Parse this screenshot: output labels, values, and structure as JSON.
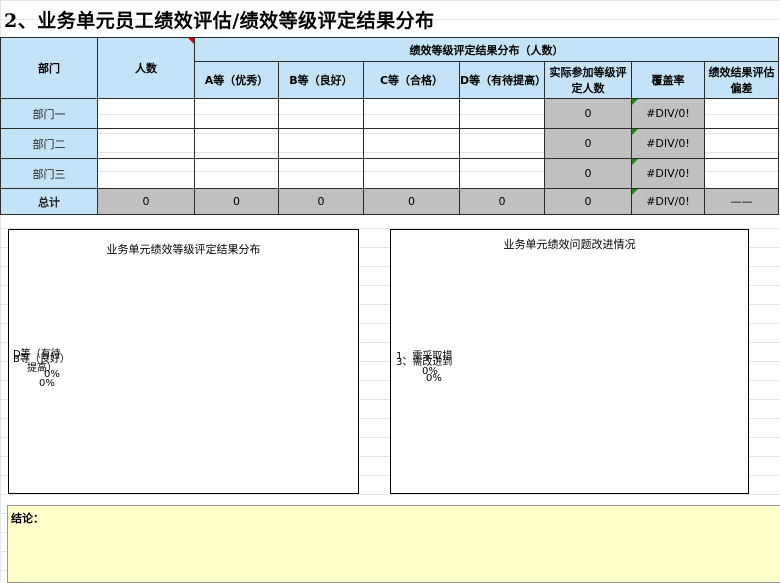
{
  "title": "2、业务单元员工绩效评估/绩效等级评定结果分布",
  "table": {
    "header": {
      "dept": "部门",
      "count": "人数",
      "group": "绩效等级评定结果分布（人数）",
      "a": "A等（优秀）",
      "b": "B等（良好）",
      "c": "C等（合格）",
      "d": "D等（有待提高）",
      "actual": "实际参加等级评定人数",
      "coverage": "覆盖率",
      "deviation": "绩效结果评估偏差"
    },
    "rows": [
      {
        "name": "部门一",
        "actual": "0",
        "coverage": "#DIV/0!"
      },
      {
        "name": "部门二",
        "actual": "0",
        "coverage": "#DIV/0!"
      },
      {
        "name": "部门三",
        "actual": "0",
        "coverage": "#DIV/0!"
      }
    ],
    "total": {
      "name": "总计",
      "count": "0",
      "a": "0",
      "b": "0",
      "c": "0",
      "d": "0",
      "actual": "0",
      "coverage": "#DIV/0!",
      "deviation": "——"
    }
  },
  "chart_left": {
    "title": "业务单元绩效等级评定结果分布",
    "overlap_lines": [
      "D等（有待",
      "B等（良好）",
      "提高）",
      "0%",
      "0%"
    ]
  },
  "chart_right": {
    "title": "业务单元绩效问题改进情况",
    "overlap_lines": [
      "1、需采取措",
      "3、需改进到",
      "0%",
      "0%"
    ]
  },
  "conclusion": {
    "label": "结论："
  }
}
